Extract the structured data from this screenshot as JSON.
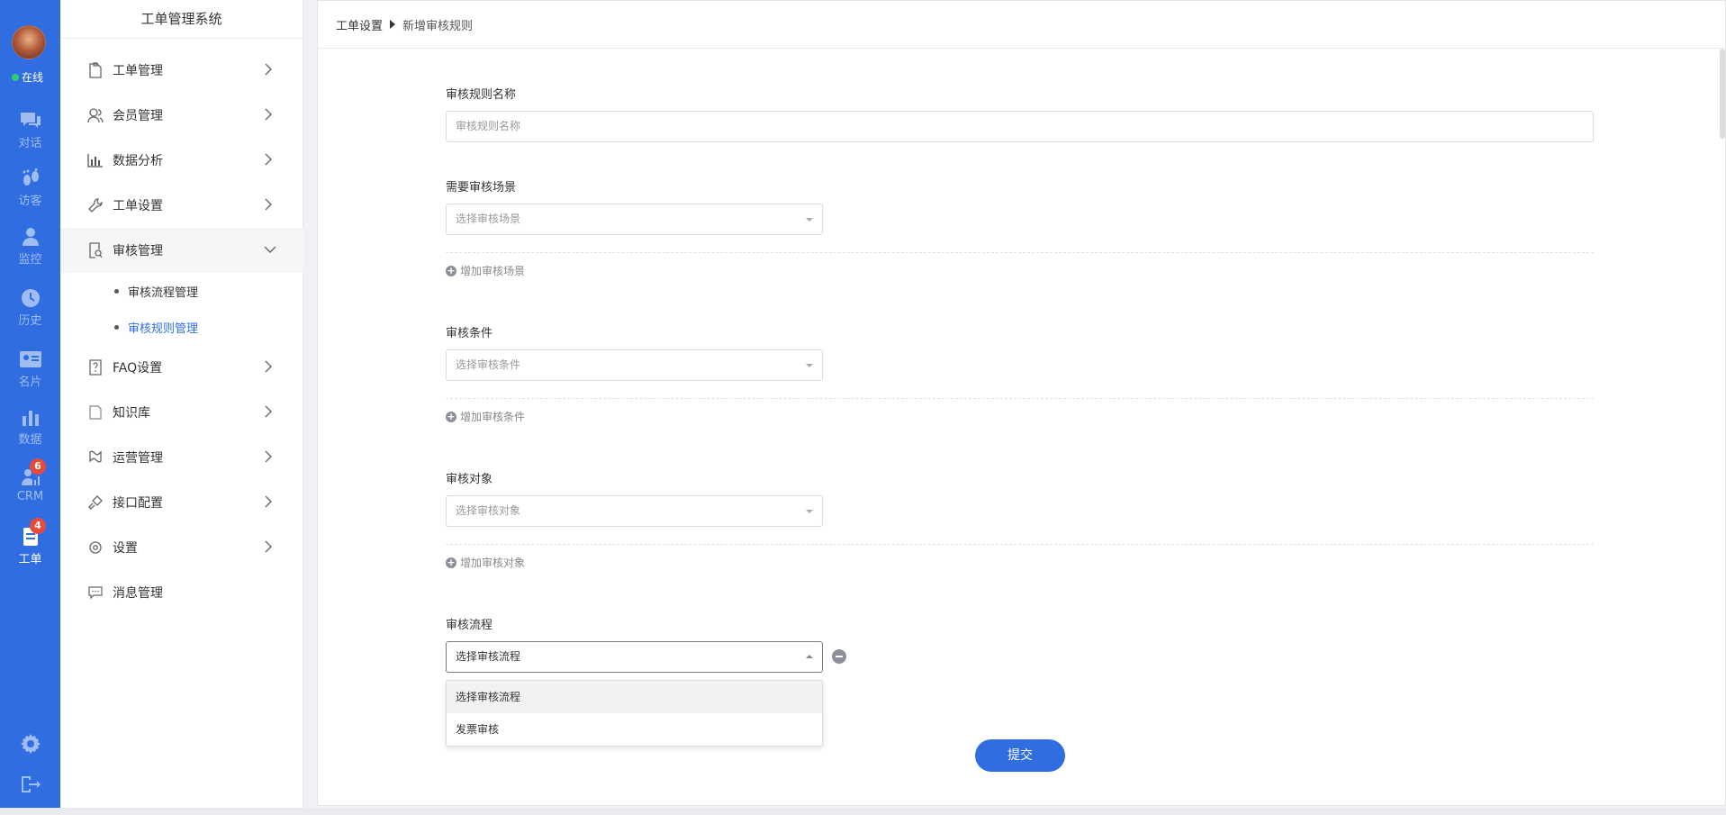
{
  "rail": {
    "status": "在线",
    "items": [
      {
        "label": "对话",
        "icon": "chat-icon"
      },
      {
        "label": "访客",
        "icon": "footprint-icon"
      },
      {
        "label": "监控",
        "icon": "monitor-user-icon"
      },
      {
        "label": "历史",
        "icon": "clock-icon"
      },
      {
        "label": "名片",
        "icon": "card-icon"
      },
      {
        "label": "数据",
        "icon": "bar-chart-icon"
      },
      {
        "label": "CRM",
        "icon": "crm-icon",
        "badge": "6"
      },
      {
        "label": "工单",
        "icon": "ticket-icon",
        "badge": "4"
      }
    ]
  },
  "sidebar": {
    "title": "工单管理系统",
    "menu": [
      {
        "label": "工单管理",
        "icon": "ticket-doc-icon"
      },
      {
        "label": "会员管理",
        "icon": "members-icon"
      },
      {
        "label": "数据分析",
        "icon": "bar-chart-icon"
      },
      {
        "label": "工单设置",
        "icon": "wrench-icon"
      },
      {
        "label": "审核管理",
        "icon": "audit-icon"
      },
      {
        "label": "FAQ设置",
        "icon": "faq-icon"
      },
      {
        "label": "知识库",
        "icon": "book-icon"
      },
      {
        "label": "运营管理",
        "icon": "operations-icon"
      },
      {
        "label": "接口配置",
        "icon": "plug-icon"
      },
      {
        "label": "设置",
        "icon": "gear-icon"
      },
      {
        "label": "消息管理",
        "icon": "message-icon"
      }
    ],
    "submenu": [
      {
        "label": "审核流程管理"
      },
      {
        "label": "审核规则管理"
      }
    ]
  },
  "breadcrumb": {
    "parent": "工单设置",
    "current": "新增审核规则"
  },
  "form": {
    "name_label": "审核规则名称",
    "name_placeholder": "审核规则名称",
    "scene_label": "需要审核场景",
    "scene_placeholder": "选择审核场景",
    "add_scene": "增加审核场景",
    "condition_label": "审核条件",
    "condition_placeholder": "选择审核条件",
    "add_condition": "增加审核条件",
    "target_label": "审核对象",
    "target_placeholder": "选择审核对象",
    "add_target": "增加审核对象",
    "flow_label": "审核流程",
    "flow_value": "选择审核流程",
    "flow_options": [
      "选择审核流程",
      "发票审核"
    ],
    "submit": "提交"
  },
  "colors": {
    "accent": "#2f6de1",
    "badge": "#e64c3c",
    "online": "#2ecc71"
  }
}
